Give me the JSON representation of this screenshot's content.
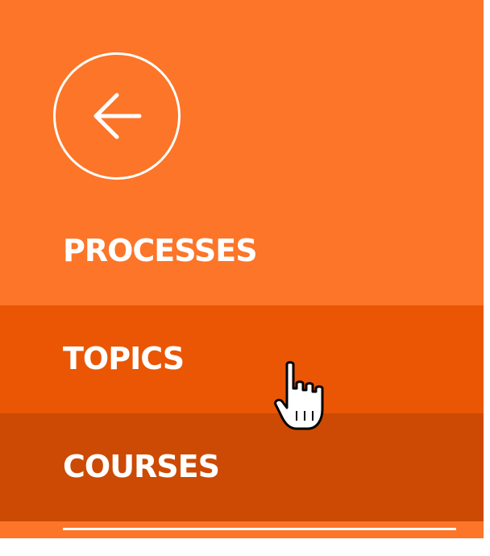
{
  "back_button": {
    "icon": "arrow-left-icon"
  },
  "menu": {
    "items": [
      {
        "label": "PROCESSES",
        "state": "normal"
      },
      {
        "label": "TOPICS",
        "state": "hover"
      },
      {
        "label": "COURSES",
        "state": "selected"
      }
    ]
  },
  "colors": {
    "panel_background": "#fc7528",
    "hover_background": "#ea5604",
    "selected_background": "#cc4a03",
    "foreground": "#ffffff"
  }
}
